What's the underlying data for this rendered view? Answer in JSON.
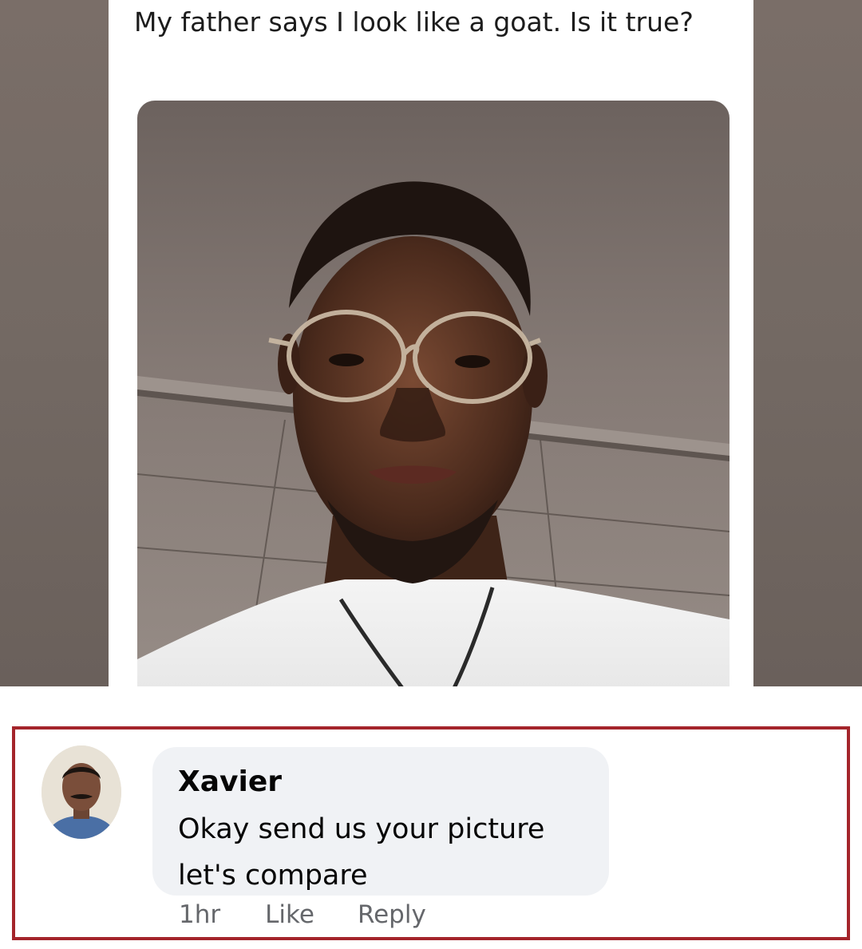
{
  "post": {
    "text": "My father says I look like a goat. Is it true?",
    "photo": {
      "description_icon": "selfie-photo"
    }
  },
  "comment": {
    "avatar_icon": "user-avatar",
    "author": "Xavier",
    "text": "Okay send us your picture let's compare",
    "time": "1hr",
    "like_label": "Like",
    "reply_label": "Reply"
  },
  "colors": {
    "highlight_border": "#a4252b",
    "bubble_bg": "#f0f2f5",
    "meta_text": "#65676b"
  }
}
